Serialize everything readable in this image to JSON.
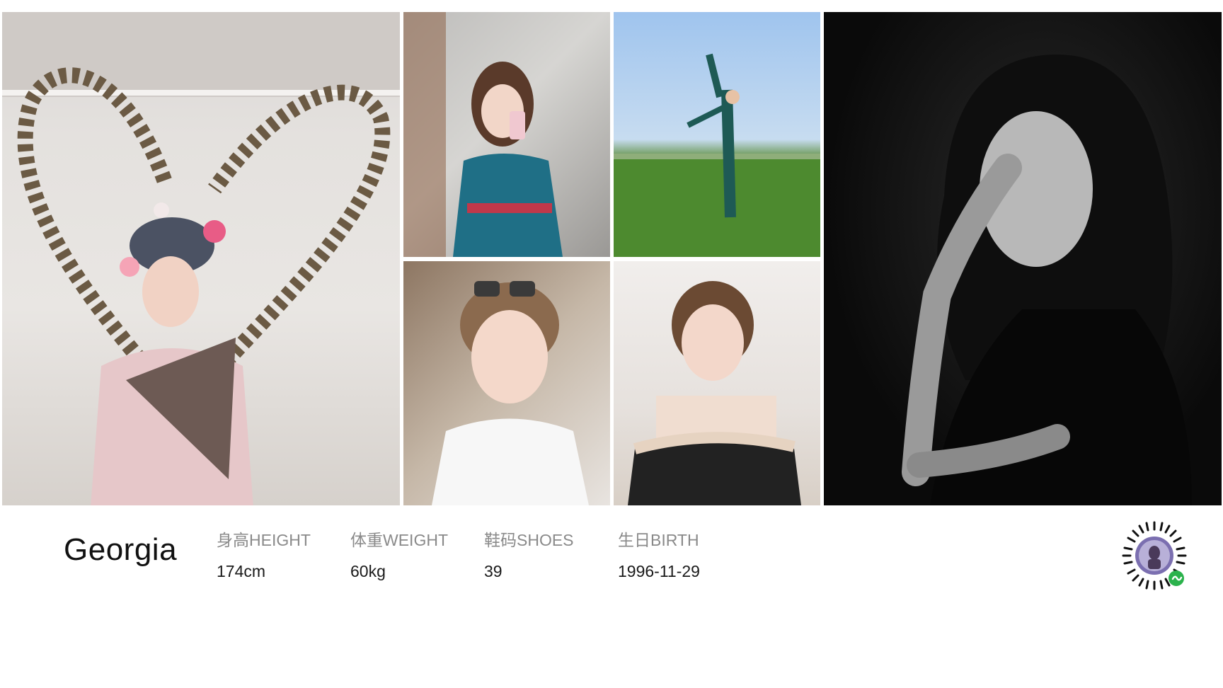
{
  "profile": {
    "name": "Georgia",
    "stats": [
      {
        "label": "身高HEIGHT",
        "value": "174cm"
      },
      {
        "label": "体重WEIGHT",
        "value": "60kg"
      },
      {
        "label": "鞋码SHOES",
        "value": "39"
      },
      {
        "label": "生日BIRTH",
        "value": "1996-11-29"
      }
    ]
  },
  "photos": [
    {
      "name": "opera-costume-photo"
    },
    {
      "name": "mirror-selfie-photo"
    },
    {
      "name": "field-dance-photo"
    },
    {
      "name": "sunglasses-selfie-photo"
    },
    {
      "name": "strapless-top-photo"
    },
    {
      "name": "bw-portrait-photo"
    }
  ],
  "qr": {
    "icon": "mini-program-code-icon",
    "accent": "#2bb24c"
  }
}
